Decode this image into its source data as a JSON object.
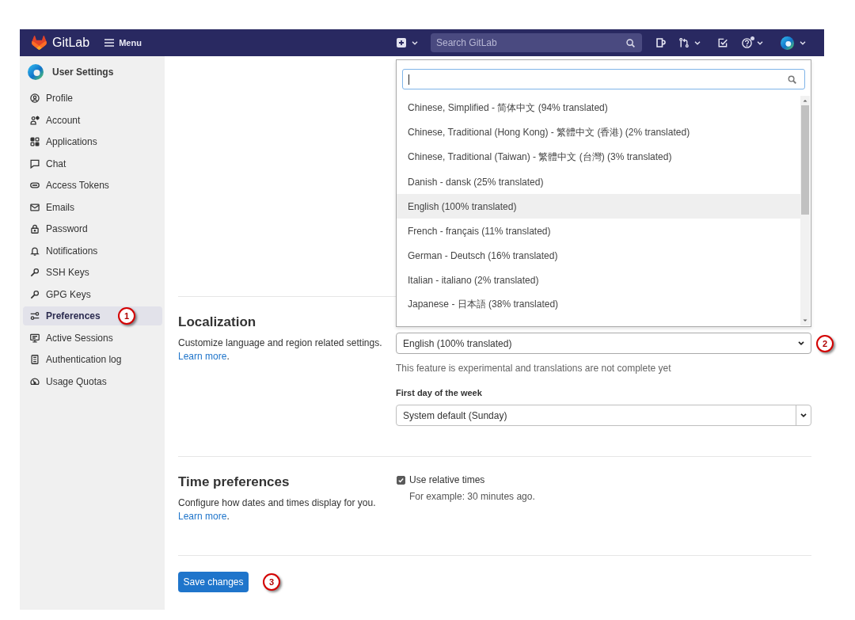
{
  "navbar": {
    "brand": "GitLab",
    "menu_label": "Menu",
    "search": {
      "placeholder": "Search GitLab"
    }
  },
  "sidebar": {
    "title": "User Settings",
    "items": [
      {
        "label": "Profile",
        "selected": false
      },
      {
        "label": "Account",
        "selected": false
      },
      {
        "label": "Applications",
        "selected": false
      },
      {
        "label": "Chat",
        "selected": false
      },
      {
        "label": "Access Tokens",
        "selected": false
      },
      {
        "label": "Emails",
        "selected": false
      },
      {
        "label": "Password",
        "selected": false
      },
      {
        "label": "Notifications",
        "selected": false
      },
      {
        "label": "SSH Keys",
        "selected": false
      },
      {
        "label": "GPG Keys",
        "selected": false
      },
      {
        "label": "Preferences",
        "selected": true,
        "callout": "1"
      },
      {
        "label": "Active Sessions",
        "selected": false
      },
      {
        "label": "Authentication log",
        "selected": false
      },
      {
        "label": "Usage Quotas",
        "selected": false
      }
    ]
  },
  "localization": {
    "title": "Localization",
    "description": "Customize language and region related settings.",
    "link": "Learn more",
    "link_suffix": ".",
    "language": {
      "value": "English (100% translated)",
      "expanded": true,
      "callout": "2",
      "options": [
        {
          "label": "Chinese, Simplified - 简体中文 (94% translated)",
          "selected": false
        },
        {
          "label": "Chinese, Traditional (Hong Kong) - 繁體中文 (香港) (2% translated)",
          "selected": false
        },
        {
          "label": "Chinese, Traditional (Taiwan) - 繁體中文 (台灣) (3% translated)",
          "selected": false
        },
        {
          "label": "Danish - dansk (25% translated)",
          "selected": false
        },
        {
          "label": "English (100% translated)",
          "selected": true
        },
        {
          "label": "French - français (11% translated)",
          "selected": false
        },
        {
          "label": "German - Deutsch (16% translated)",
          "selected": false
        },
        {
          "label": "Italian - italiano (2% translated)",
          "selected": false
        },
        {
          "label": "Japanese - 日本語 (38% translated)",
          "selected": false
        }
      ]
    },
    "help_text": "This feature is experimental and translations are not complete yet",
    "first_day": {
      "label": "First day of the week",
      "value": "System default (Sunday)"
    }
  },
  "time_preferences": {
    "title": "Time preferences",
    "description": "Configure how dates and times display for you.",
    "link": "Learn more",
    "link_suffix": ".",
    "relative_times": {
      "label": "Use relative times",
      "checked": true,
      "hint": "For example: 30 minutes ago."
    }
  },
  "save_button": {
    "label": "Save changes",
    "callout": "3"
  }
}
